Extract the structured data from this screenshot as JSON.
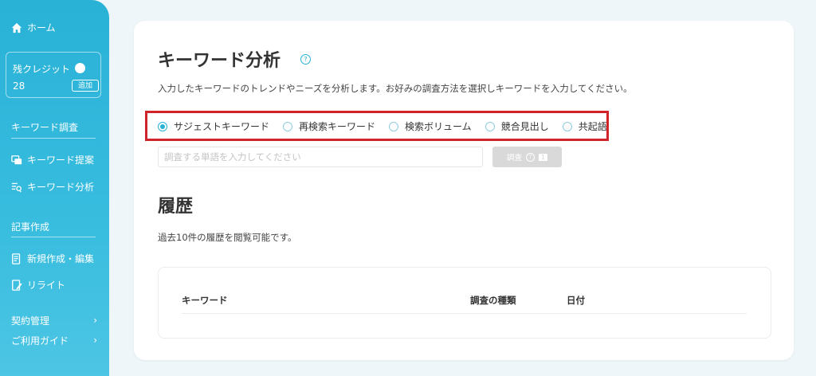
{
  "sidebar": {
    "home_label": "ホーム",
    "credit": {
      "label": "残クレジット",
      "value": "28",
      "add_label": "追加"
    },
    "sections": [
      {
        "title": "キーワード調査",
        "items": [
          {
            "label": "キーワード提案",
            "icon": "keyword-suggest-icon"
          },
          {
            "label": "キーワード分析",
            "icon": "keyword-analysis-icon"
          }
        ]
      },
      {
        "title": "記事作成",
        "items": [
          {
            "label": "新規作成・編集",
            "icon": "edit-document-icon"
          },
          {
            "label": "リライト",
            "icon": "rewrite-icon"
          }
        ]
      }
    ],
    "footer": [
      {
        "label": "契約管理"
      },
      {
        "label": "ご利用ガイド"
      }
    ]
  },
  "main": {
    "title": "キーワード分析",
    "description": "入力したキーワードのトレンドやニーズを分析します。お好みの調査方法を選択しキーワードを入力してください。",
    "options": [
      {
        "label": "サジェストキーワード",
        "selected": true
      },
      {
        "label": "再検索キーワード",
        "selected": false
      },
      {
        "label": "検索ボリューム",
        "selected": false
      },
      {
        "label": "競合見出し",
        "selected": false
      },
      {
        "label": "共起語",
        "selected": false
      }
    ],
    "search": {
      "placeholder": "調査する単語を入力してください",
      "button_label": "調査",
      "button_count": "1"
    },
    "history": {
      "title": "履歴",
      "description": "過去10件の履歴を閲覧可能です。",
      "columns": [
        "キーワード",
        "調査の種類",
        "日付"
      ]
    }
  },
  "colors": {
    "accent": "#29b1d6",
    "highlight": "#d2232a",
    "background": "#eef6f9"
  }
}
